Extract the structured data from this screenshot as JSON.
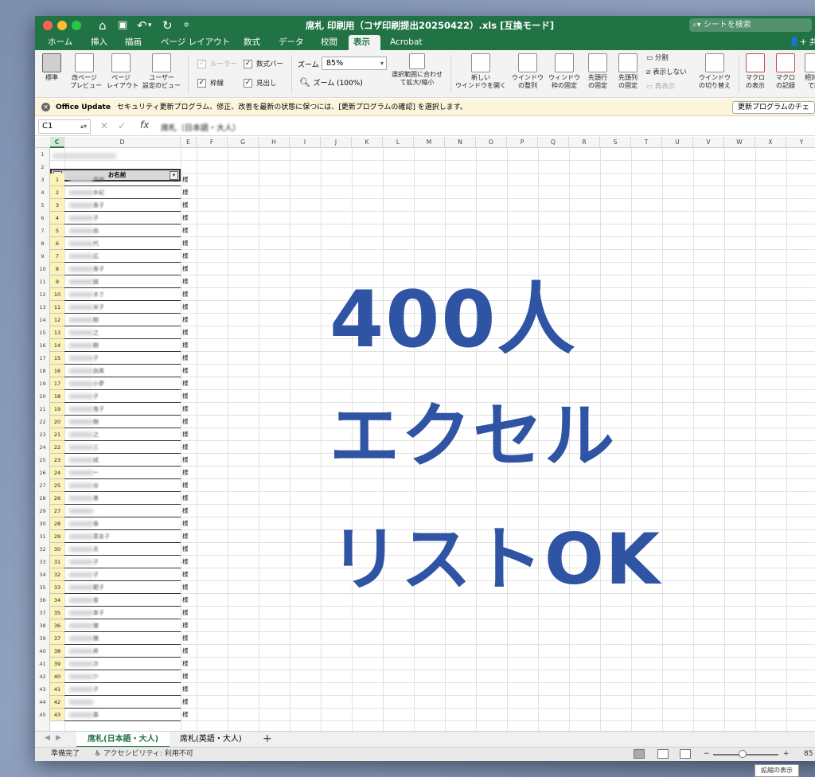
{
  "window": {
    "title": "席札 印刷用（コザ印刷提出20250422）.xls  [互換モード]",
    "search_placeholder": "シートを検索"
  },
  "menu": {
    "tabs": [
      "ホーム",
      "挿入",
      "描画",
      "ページ レイアウト",
      "数式",
      "データ",
      "校閲",
      "表示",
      "Acrobat"
    ],
    "active": "表示",
    "share": "共有"
  },
  "ribbon": {
    "view_buttons": [
      {
        "label1": "標準",
        "label2": ""
      },
      {
        "label1": "改ページ",
        "label2": "プレビュー"
      },
      {
        "label1": "ページ",
        "label2": "レイアウト"
      },
      {
        "label1": "ユーザー",
        "label2": "設定のビュー"
      }
    ],
    "checks": [
      {
        "label": "ルーラー",
        "checked": true,
        "disabled": true
      },
      {
        "label": "数式バー",
        "checked": true,
        "disabled": false
      },
      {
        "label": "枠線",
        "checked": true,
        "disabled": false
      },
      {
        "label": "見出し",
        "checked": true,
        "disabled": false
      }
    ],
    "zoom_label": "ズーム",
    "zoom_value": "85%",
    "zoom100_label": "ズーム (100%)",
    "fit_selection": [
      "選択範囲に合わせ",
      "て拡大/縮小"
    ],
    "window_buttons": [
      {
        "label1": "新しい",
        "label2": "ウインドウを開く"
      },
      {
        "label1": "ウインドウ",
        "label2": "の整列"
      },
      {
        "label1": "ウィンドウ",
        "label2": "枠の固定"
      },
      {
        "label1": "先頭行",
        "label2": "の固定"
      },
      {
        "label1": "先頭列",
        "label2": "の固定"
      }
    ],
    "split": "分割",
    "hide": "表示しない",
    "unhide": "再表示",
    "switch_window": [
      "ウインドウ",
      "の切り替え"
    ],
    "macro_buttons": [
      {
        "label1": "マクロ",
        "label2": "の表示"
      },
      {
        "label1": "マクロ",
        "label2": "の記録"
      },
      {
        "label1": "相対で",
        "label2": "で記"
      }
    ]
  },
  "notification": {
    "title": "Office Update",
    "message": "セキュリティ更新プログラム、修正、改善を最新の状態に保つには、[更新プログラムの確認] を選択します。",
    "button": "更新プログラムのチェ"
  },
  "formula_bar": {
    "cell_ref": "C1",
    "fx": "fx",
    "value": "席札（日本語・大人）"
  },
  "columns": [
    "C",
    "D",
    "E",
    "F",
    "G",
    "H",
    "I",
    "J",
    "K",
    "L",
    "M",
    "N",
    "O",
    "P",
    "Q",
    "R",
    "S",
    "T",
    "U",
    "V",
    "W",
    "X",
    "Y"
  ],
  "rows": [
    "1",
    "2",
    "3",
    "4",
    "5",
    "6",
    "7",
    "8",
    "9",
    "10",
    "11",
    "12",
    "13",
    "14",
    "15",
    "16",
    "17",
    "18",
    "19",
    "20",
    "21",
    "22",
    "23",
    "24",
    "25",
    "26",
    "27",
    "28",
    "29",
    "30",
    "31",
    "32",
    "33",
    "34",
    "35",
    "36",
    "37",
    "38",
    "39",
    "40",
    "41",
    "42",
    "43",
    "44",
    "45"
  ],
  "list": {
    "header": "お名前",
    "suffix": "様",
    "numbers": [
      "1",
      "2",
      "3",
      "4",
      "5",
      "6",
      "7",
      "8",
      "9",
      "10",
      "11",
      "12",
      "13",
      "14",
      "15",
      "16",
      "17",
      "18",
      "19",
      "20",
      "21",
      "22",
      "23",
      "24",
      "25",
      "26",
      "27",
      "28",
      "29",
      "30",
      "31",
      "32",
      "33",
      "34",
      "35",
      "36",
      "37",
      "38",
      "39",
      "40",
      "41",
      "42",
      "43"
    ],
    "name_fragments": [
      "英伸",
      "水紀",
      "香子",
      "子",
      "由",
      "代",
      "広",
      "香子",
      "誠",
      "まさ",
      "米子",
      "樹",
      "之",
      "樹",
      "子",
      "由美",
      "小夢",
      "子",
      "鬼子",
      "樹",
      "之",
      "三",
      "成",
      "ー",
      "台",
      "勇",
      "",
      "香",
      "菜名子",
      "夫",
      "子",
      "子",
      "範子",
      "俊",
      "幸子",
      "徹",
      "雅",
      "昇",
      "次",
      "少",
      "子",
      "",
      "亜"
    ]
  },
  "overlay": {
    "line1": "400人",
    "line2": "エクセル",
    "line3": "リストOK",
    "color": "#2f54a3"
  },
  "sheet_tabs": {
    "tabs": [
      "席札(日本語・大人)",
      "席札(英語・大人)"
    ],
    "active": "席札(日本語・大人)",
    "add": "+"
  },
  "status": {
    "ready": "準備完了",
    "accessibility": "アクセシビリティ: 利用不可",
    "zoom": "85",
    "tooltip": "拡縮の表示"
  },
  "colors": {
    "excel_green": "#217346",
    "highlight_yellow": "#fbf3b8"
  }
}
